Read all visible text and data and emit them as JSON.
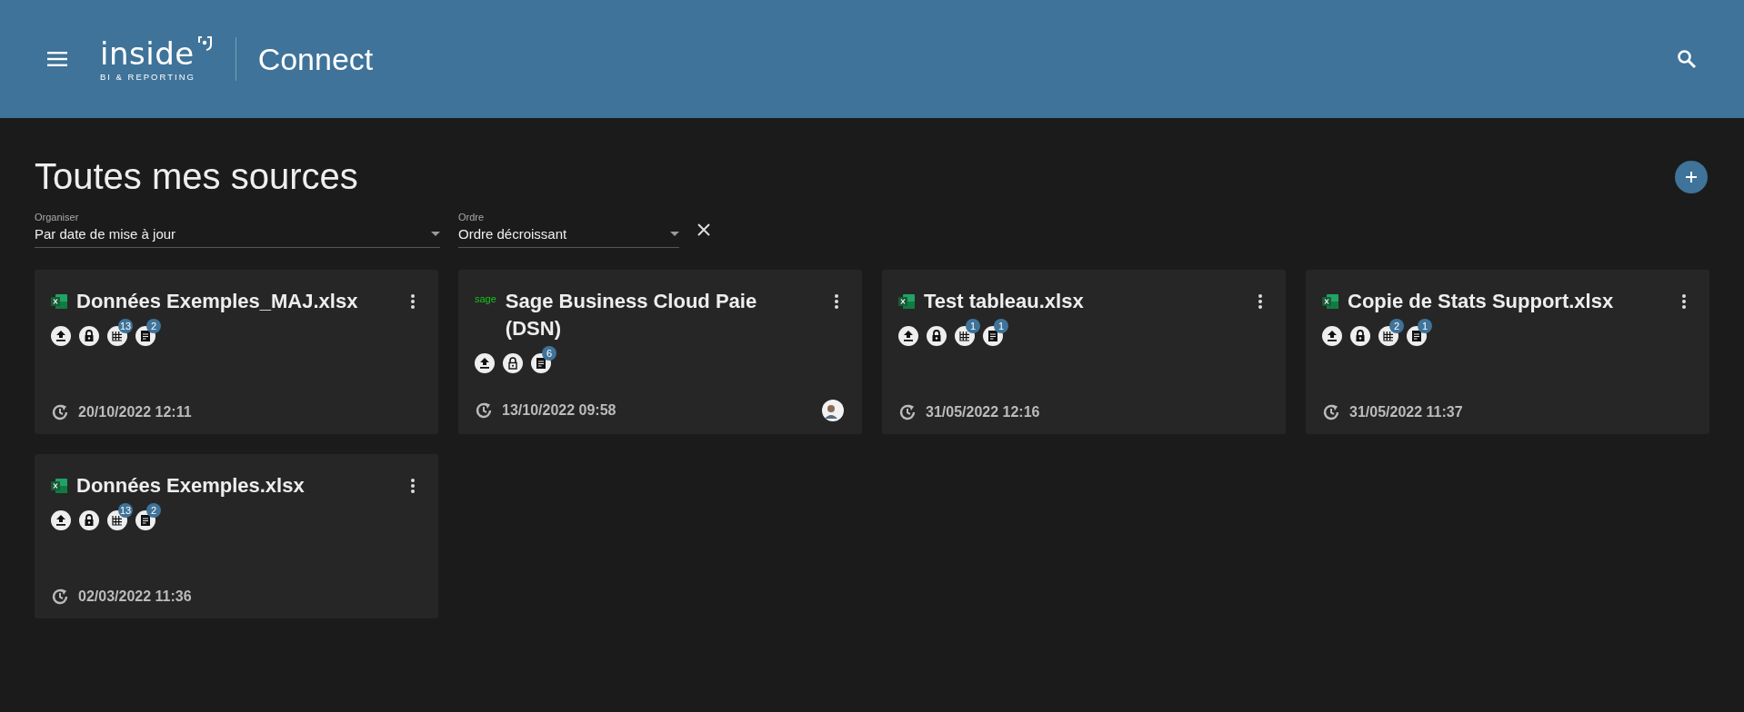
{
  "header": {
    "logo_text": "inside",
    "logo_subtitle": "BI & REPORTING",
    "app_title": "Connect"
  },
  "page_title": "Toutes mes sources",
  "filters": [
    {
      "label": "Organiser",
      "value": "Par date de mise à jour"
    },
    {
      "label": "Ordre",
      "value": "Ordre décroissant"
    }
  ],
  "sources": [
    {
      "kind": "excel",
      "title": "Données Exemples_MAJ.xlsx",
      "locked": true,
      "tables_count": "13",
      "reports_count": "2",
      "updated": "20/10/2022 12:11"
    },
    {
      "kind": "sage",
      "logo_text": "sage",
      "title": "Sage Business Cloud Paie (DSN)",
      "locked": false,
      "reports_count": "6",
      "updated": "13/10/2022 09:58",
      "avatar": true
    },
    {
      "kind": "excel",
      "title": "Test tableau.xlsx",
      "locked": true,
      "tables_count": "1",
      "reports_count": "1",
      "updated": "31/05/2022 12:16"
    },
    {
      "kind": "excel",
      "title": "Copie de Stats Support.xlsx",
      "locked": true,
      "tables_count": "2",
      "reports_count": "1",
      "updated": "31/05/2022 11:37"
    },
    {
      "kind": "excel",
      "title": "Données Exemples.xlsx",
      "locked": true,
      "tables_count": "13",
      "reports_count": "2",
      "updated": "02/03/2022 11:36"
    }
  ]
}
